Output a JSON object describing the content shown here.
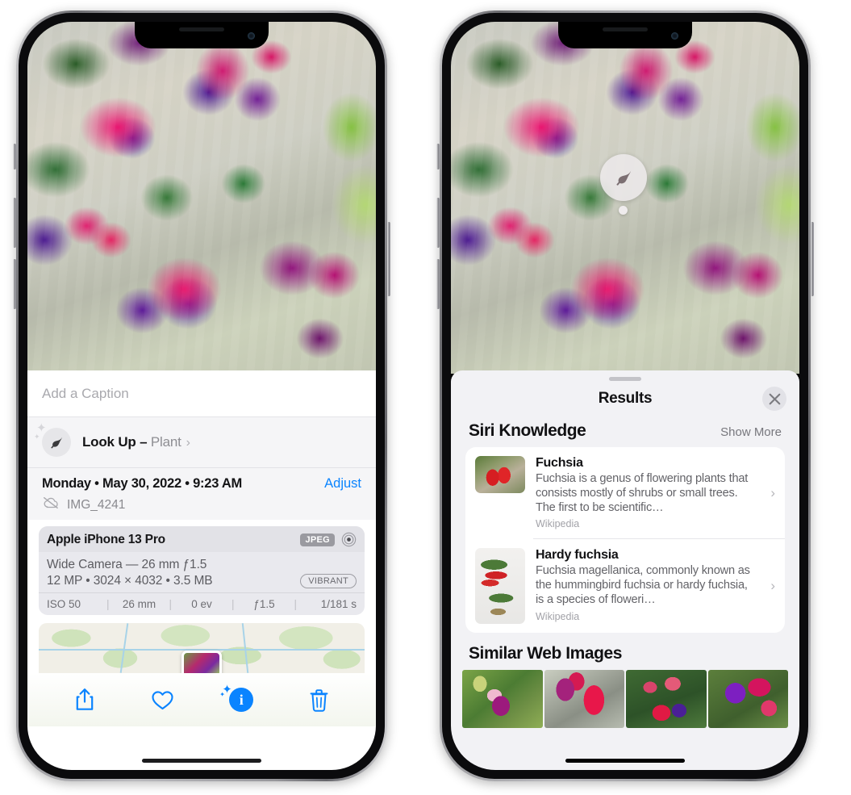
{
  "left_phone": {
    "caption_placeholder": "Add a Caption",
    "lookup": {
      "label": "Look Up – ",
      "subject": "Plant",
      "chevron": "›",
      "icon": "leaf-icon"
    },
    "metadata": {
      "date_line": "Monday • May 30, 2022 • 9:23 AM",
      "adjust_label": "Adjust",
      "filename": "IMG_4241",
      "cloud_icon": "cloud-slash-icon"
    },
    "exif": {
      "model": "Apple iPhone 13 Pro",
      "format_badge": "JPEG",
      "raw_icon": "raw-target-icon",
      "lens_line": "Wide Camera — 26 mm ƒ1.5",
      "size_line": "12 MP • 3024 × 4032 • 3.5 MB",
      "style_badge": "VIBRANT",
      "strip": [
        "ISO 50",
        "26 mm",
        "0 ev",
        "ƒ1.5",
        "1/181 s"
      ]
    },
    "toolbar": {
      "share_icon": "share-icon",
      "favorite_icon": "heart-icon",
      "info_icon": "info-sparkle-icon",
      "delete_icon": "trash-icon"
    }
  },
  "right_phone": {
    "visual_lookup_badge": "leaf-icon",
    "results": {
      "title": "Results",
      "close_icon": "close-icon",
      "siri_knowledge": {
        "section_title": "Siri Knowledge",
        "show_more": "Show More",
        "items": [
          {
            "title": "Fuchsia",
            "description": "Fuchsia is a genus of flowering plants that consists mostly of shrubs or small trees. The first to be scientific…",
            "source": "Wikipedia",
            "chevron": "›"
          },
          {
            "title": "Hardy fuchsia",
            "description": "Fuchsia magellanica, commonly known as the hummingbird fuchsia or hardy fuchsia, is a species of floweri…",
            "source": "Wikipedia",
            "chevron": "›"
          }
        ]
      },
      "similar_web_images": {
        "section_title": "Similar Web Images",
        "count": 4
      }
    }
  },
  "colors": {
    "accent_blue": "#0a84ff",
    "sheet_bg": "#f2f2f5",
    "card_bg": "#ffffff",
    "exif_bg": "#e9e9ee",
    "secondary_text": "#8e8e93"
  }
}
